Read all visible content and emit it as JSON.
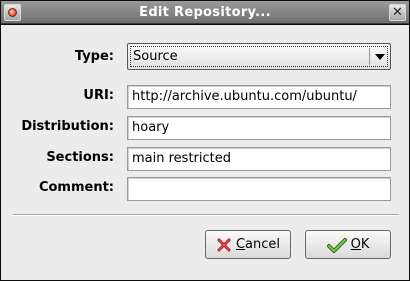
{
  "window": {
    "title": "Edit Repository..."
  },
  "form": {
    "type_label": "Type:",
    "type_value": "Source",
    "uri_label": "URI:",
    "uri_value": "http://archive.ubuntu.com/ubuntu/",
    "distribution_label": "Distribution:",
    "distribution_value": "hoary",
    "sections_label": "Sections:",
    "sections_value": "main restricted",
    "comment_label": "Comment:",
    "comment_value": ""
  },
  "buttons": {
    "cancel_mnemonic": "C",
    "cancel_rest": "ancel",
    "ok_mnemonic": "O",
    "ok_rest": "K"
  },
  "icons": {
    "window_menu": "window-menu-icon",
    "close": "close-icon",
    "combo_arrow": "chevron-down-icon",
    "cancel": "red-x-icon",
    "ok": "green-checkmark-icon"
  }
}
